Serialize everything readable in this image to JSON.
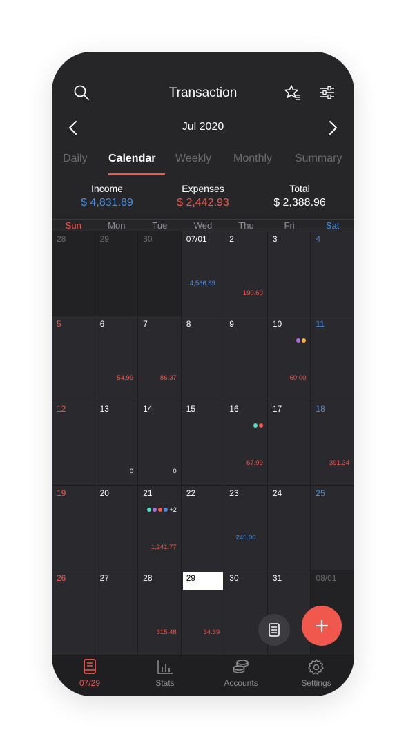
{
  "header": {
    "title": "Transaction",
    "month": "Jul 2020",
    "icons": {
      "search": "search-icon",
      "favorite": "star-list-icon",
      "filter": "sliders-icon",
      "prev": "chevron-left-icon",
      "next": "chevron-right-icon"
    }
  },
  "tabs": [
    {
      "label": "Daily",
      "active": false
    },
    {
      "label": "Calendar",
      "active": true
    },
    {
      "label": "Weekly",
      "active": false
    },
    {
      "label": "Monthly",
      "active": false
    },
    {
      "label": "Summary",
      "active": false
    }
  ],
  "summary": {
    "income_label": "Income",
    "income_value": "$ 4,831.89",
    "expenses_label": "Expenses",
    "expenses_value": "$ 2,442.93",
    "total_label": "Total",
    "total_value": "$ 2,388.96"
  },
  "colors": {
    "income": "#4a8fe3",
    "expense": "#f0574d",
    "accent": "#f0574d"
  },
  "weekdays": [
    "Sun",
    "Mon",
    "Tue",
    "Wed",
    "Thu",
    "Fri",
    "Sat"
  ],
  "weeks": [
    [
      {
        "day": "28",
        "other": true
      },
      {
        "day": "29",
        "other": true
      },
      {
        "day": "30",
        "other": true
      },
      {
        "day": "07/01",
        "income": "4,586.89"
      },
      {
        "day": "2",
        "expense": "190.60"
      },
      {
        "day": "3"
      },
      {
        "day": "4"
      }
    ],
    [
      {
        "day": "5"
      },
      {
        "day": "6",
        "expense": "54.99"
      },
      {
        "day": "7",
        "expense": "86.37"
      },
      {
        "day": "8"
      },
      {
        "day": "9"
      },
      {
        "day": "10",
        "expense": "60.00",
        "dots": [
          "#b36ce0",
          "#f5b13d"
        ]
      },
      {
        "day": "11"
      }
    ],
    [
      {
        "day": "12"
      },
      {
        "day": "13",
        "zero": "0"
      },
      {
        "day": "14",
        "zero": "0"
      },
      {
        "day": "15"
      },
      {
        "day": "16",
        "expense": "67.99",
        "dots": [
          "#4fe0c0",
          "#f0574d"
        ]
      },
      {
        "day": "17"
      },
      {
        "day": "18",
        "expense": "391.34"
      }
    ],
    [
      {
        "day": "19"
      },
      {
        "day": "20"
      },
      {
        "day": "21",
        "expense": "1,241.77",
        "dots": [
          "#4fe0c0",
          "#b36ce0",
          "#f0574d",
          "#4a8fe3"
        ],
        "more": "+2"
      },
      {
        "day": "22"
      },
      {
        "day": "23",
        "income": "245.00"
      },
      {
        "day": "24"
      },
      {
        "day": "25"
      }
    ],
    [
      {
        "day": "26"
      },
      {
        "day": "27"
      },
      {
        "day": "28",
        "expense": "315.48"
      },
      {
        "day": "29",
        "today": true,
        "expense": "34.39"
      },
      {
        "day": "30"
      },
      {
        "day": "31"
      },
      {
        "day": "08/01",
        "other": true
      }
    ]
  ],
  "bottom_nav": [
    {
      "label": "07/29",
      "icon": "book-icon",
      "active": true
    },
    {
      "label": "Stats",
      "icon": "bar-chart-icon",
      "active": false
    },
    {
      "label": "Accounts",
      "icon": "coins-icon",
      "active": false
    },
    {
      "label": "Settings",
      "icon": "gear-icon",
      "active": false
    }
  ]
}
